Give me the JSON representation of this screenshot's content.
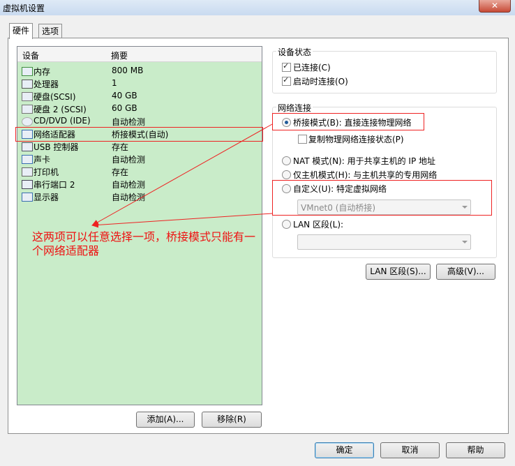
{
  "window": {
    "title": "虚拟机设置",
    "close_icon": "close-icon"
  },
  "tabs": [
    {
      "label": "硬件"
    },
    {
      "label": "选项"
    }
  ],
  "device_list": {
    "col_device": "设备",
    "col_summary": "摘要",
    "rows": [
      {
        "name": "内存",
        "summary": "800 MB",
        "icon": "memory-icon"
      },
      {
        "name": "处理器",
        "summary": "1",
        "icon": "processor-icon"
      },
      {
        "name": "硬盘(SCSI)",
        "summary": "40 GB",
        "icon": "hard-disk-icon"
      },
      {
        "name": "硬盘 2 (SCSI)",
        "summary": "60 GB",
        "icon": "hard-disk-icon"
      },
      {
        "name": "CD/DVD (IDE)",
        "summary": "自动检测",
        "icon": "cd-dvd-icon"
      },
      {
        "name": "网络适配器",
        "summary": "桥接模式(自动)",
        "icon": "network-adapter-icon"
      },
      {
        "name": "USB 控制器",
        "summary": "存在",
        "icon": "usb-icon"
      },
      {
        "name": "声卡",
        "summary": "自动检测",
        "icon": "sound-card-icon"
      },
      {
        "name": "打印机",
        "summary": "存在",
        "icon": "printer-icon"
      },
      {
        "name": "串行端口 2",
        "summary": "自动检测",
        "icon": "serial-port-icon"
      },
      {
        "name": "显示器",
        "summary": "自动检测",
        "icon": "display-icon"
      }
    ]
  },
  "list_buttons": {
    "add": "添加(A)...",
    "remove": "移除(R)"
  },
  "device_status": {
    "title": "设备状态",
    "connected": {
      "label": "已连接(C)",
      "checked": true
    },
    "connect_at_power_on": {
      "label": "启动时连接(O)",
      "checked": true
    }
  },
  "network_connection": {
    "title": "网络连接",
    "bridged": {
      "label": "桥接模式(B): 直接连接物理网络",
      "selected": true
    },
    "replicate": {
      "label": "复制物理网络连接状态(P)",
      "checked": false
    },
    "nat": {
      "label": "NAT 模式(N): 用于共享主机的 IP 地址",
      "selected": false
    },
    "host_only": {
      "label": "仅主机模式(H): 与主机共享的专用网络",
      "selected": false
    },
    "custom": {
      "label": "自定义(U): 特定虚拟网络",
      "selected": false,
      "value": "VMnet0 (自动桥接)"
    },
    "lan_segment": {
      "label": "LAN 区段(L):",
      "selected": false,
      "value": ""
    }
  },
  "network_buttons": {
    "lan_segments": "LAN 区段(S)...",
    "advanced": "高级(V)..."
  },
  "annotation": {
    "text": "这两项可以任意选择一项，桥接模式只能有一个网络适配器",
    "color": "#ee1111"
  },
  "footer": {
    "ok": "确定",
    "cancel": "取消",
    "help": "帮助"
  }
}
